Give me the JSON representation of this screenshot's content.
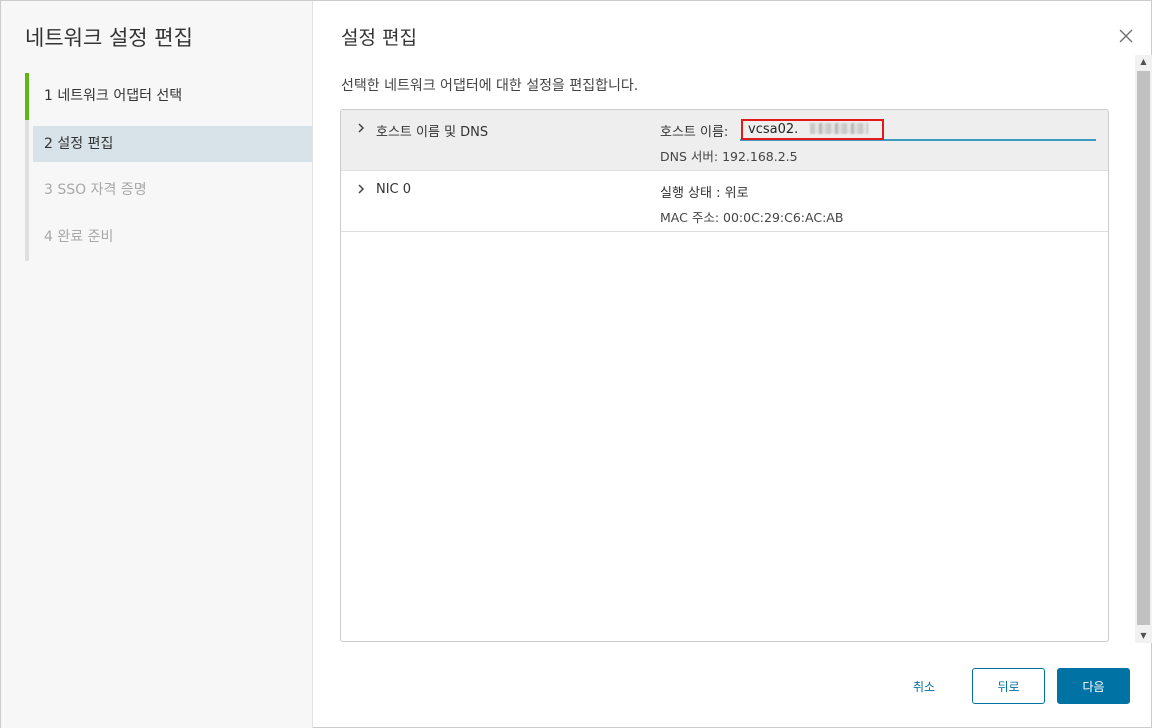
{
  "sidebar": {
    "title": "네트워크 설정 편집",
    "steps": [
      {
        "label": "1 네트워크 어댑터 선택",
        "state": "done"
      },
      {
        "label": "2 설정 편집",
        "state": "current"
      },
      {
        "label": "3 SSO 자격 증명",
        "state": "disabled"
      },
      {
        "label": "4 완료 준비",
        "state": "disabled"
      }
    ]
  },
  "main": {
    "title": "설정 편집",
    "description": "선택한 네트워크 어댑터에 대한 설정을 편집합니다.",
    "close_icon": "close-icon"
  },
  "grid": {
    "rows": [
      {
        "name": "호스트 이름 및 DNS",
        "host_label": "호스트 이름:",
        "host_value": "vcsa02.",
        "dns": "DNS 서버: 192.168.2.5"
      },
      {
        "name": "NIC 0",
        "status": "실행 상태 : 위로",
        "mac": "MAC 주소: 00:0C:29:C6:AC:AB"
      }
    ]
  },
  "footer": {
    "cancel": "취소",
    "back": "뒤로",
    "next": "다음"
  },
  "colors": {
    "accent": "#0072a3",
    "step_done": "#60b515",
    "step_current_bg": "#d8e3e9",
    "highlight_box": "#e11a1a",
    "input_underline": "#3d9ac0"
  }
}
